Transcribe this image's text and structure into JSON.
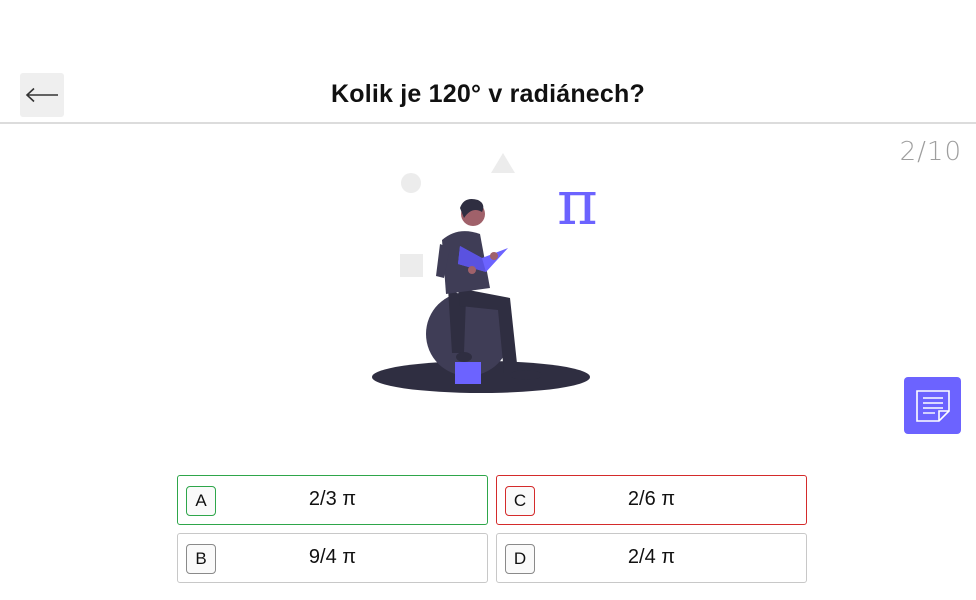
{
  "header": {
    "back_icon": "arrow-left-icon",
    "question": "Kolik je 120° v radiánech?"
  },
  "progress": {
    "label": "2/10",
    "current": 2,
    "total": 10
  },
  "illustration": {
    "symbol": "π",
    "accent_color": "#6c63ff"
  },
  "notes_button": {
    "icon": "notes-icon"
  },
  "answers": [
    {
      "letter": "A",
      "text": "2/3 π",
      "state": "correct",
      "color": "#2ea64a"
    },
    {
      "letter": "B",
      "text": "9/4 π",
      "state": "neutral"
    },
    {
      "letter": "C",
      "text": "2/6 π",
      "state": "wrong",
      "color": "#d42b2b"
    },
    {
      "letter": "D",
      "text": "2/4 π",
      "state": "neutral"
    }
  ]
}
